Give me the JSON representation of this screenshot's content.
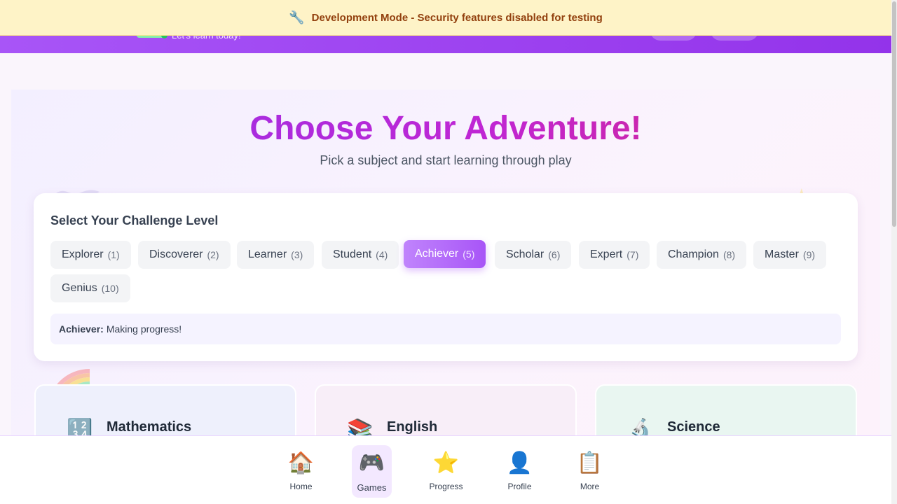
{
  "dev_banner": {
    "icon": "wrench-icon",
    "text": "Development Mode - Security features disabled for testing"
  },
  "header": {
    "greeting": "Let's learn today!"
  },
  "hero": {
    "title": "Choose Your Adventure!",
    "subtitle": "Pick a subject and start learning through play"
  },
  "level_selector": {
    "title": "Select Your Challenge Level",
    "levels": [
      {
        "label": "Explorer",
        "number": "(1)"
      },
      {
        "label": "Discoverer",
        "number": "(2)"
      },
      {
        "label": "Learner",
        "number": "(3)"
      },
      {
        "label": "Student",
        "number": "(4)"
      },
      {
        "label": "Achiever",
        "number": "(5)"
      },
      {
        "label": "Scholar",
        "number": "(6)"
      },
      {
        "label": "Expert",
        "number": "(7)"
      },
      {
        "label": "Champion",
        "number": "(8)"
      },
      {
        "label": "Master",
        "number": "(9)"
      },
      {
        "label": "Genius",
        "number": "(10)"
      }
    ],
    "selected": "Achiever",
    "description_label": "Achiever:",
    "description_text": "Making progress!",
    "accent_color": "#a855f7"
  },
  "subjects": [
    {
      "name": "Mathematics",
      "icon": "🔢",
      "icon_name": "numbers-icon",
      "color": "#eef0fc"
    },
    {
      "name": "English",
      "icon": "📚",
      "icon_name": "books-icon",
      "color": "#f8eef8"
    },
    {
      "name": "Science",
      "icon": "🔬",
      "icon_name": "microscope-icon",
      "color": "#e9f6f1"
    }
  ],
  "bottom_nav": {
    "items": [
      {
        "label": "Home",
        "icon": "🏠",
        "icon_name": "home-icon"
      },
      {
        "label": "Games",
        "icon": "🎮",
        "icon_name": "gamepad-icon"
      },
      {
        "label": "Progress",
        "icon": "⭐",
        "icon_name": "star-icon"
      },
      {
        "label": "Profile",
        "icon": "👤",
        "icon_name": "profile-icon"
      },
      {
        "label": "More",
        "icon": "📋",
        "icon_name": "clipboard-icon"
      }
    ],
    "active": "Games"
  }
}
